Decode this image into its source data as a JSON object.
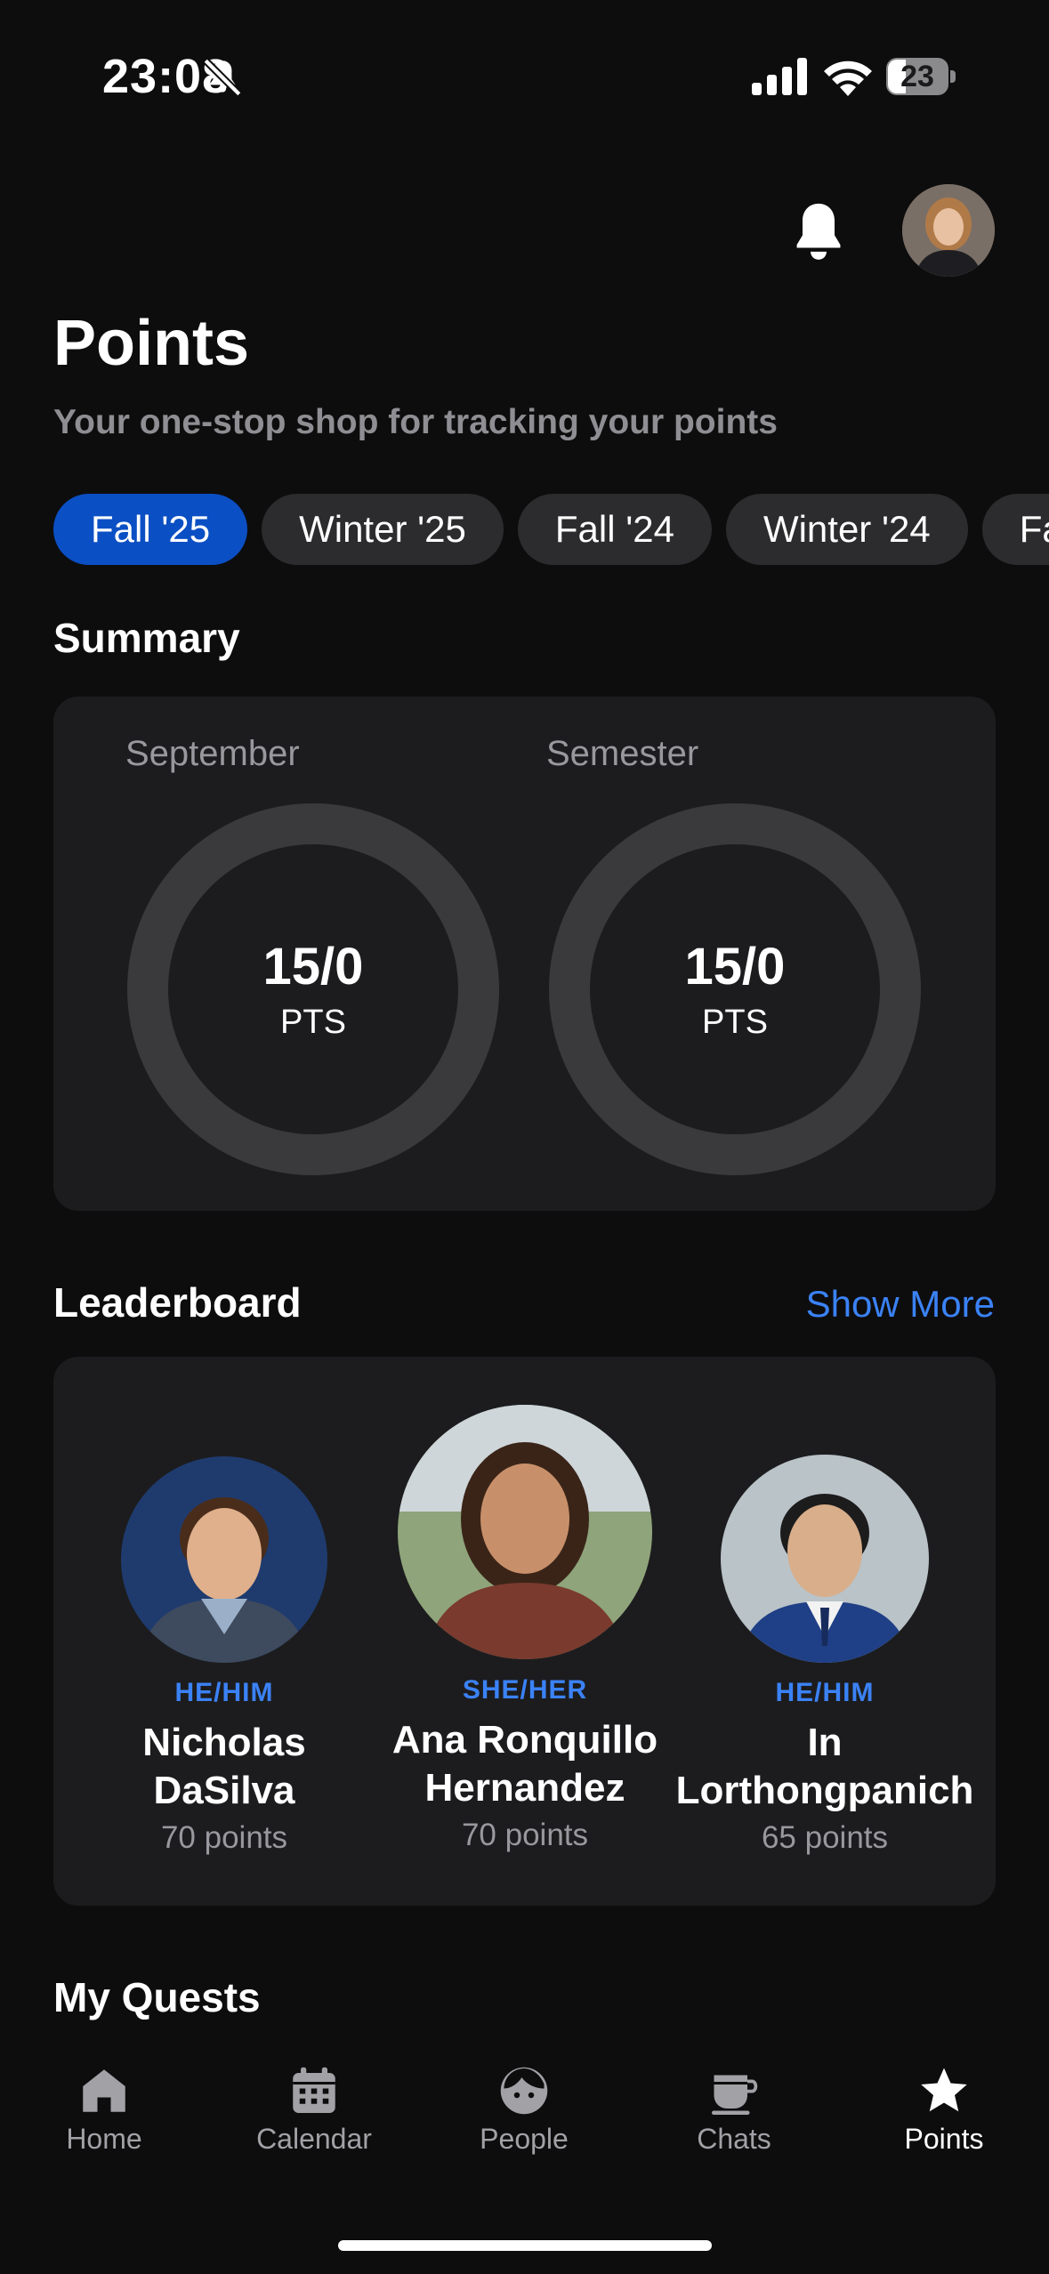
{
  "status_bar": {
    "time": "23:08",
    "battery": "23"
  },
  "header": {
    "title": "Points",
    "subtitle": "Your one-stop shop for tracking your points"
  },
  "periods": [
    "Fall '25",
    "Winter '25",
    "Fall '24",
    "Winter '24",
    "Fa"
  ],
  "active_period_index": 0,
  "summary": {
    "title": "Summary",
    "rings": [
      {
        "label": "September",
        "value": "15/0",
        "unit": "PTS",
        "progress": 0
      },
      {
        "label": "Semester",
        "value": "15/0",
        "unit": "PTS",
        "progress": 0
      }
    ]
  },
  "leaderboard": {
    "title": "Leaderboard",
    "show_more": "Show More",
    "leaders": [
      {
        "pronouns": "HE/HIM",
        "name_line1": "Nicholas",
        "name_line2": "DaSilva",
        "points": "70 points"
      },
      {
        "pronouns": "SHE/HER",
        "name_line1": "Ana Ronquillo",
        "name_line2": "Hernandez",
        "points": "70 points"
      },
      {
        "pronouns": "HE/HIM",
        "name_line1": "In",
        "name_line2": "Lorthongpanich",
        "points": "65 points"
      }
    ]
  },
  "quests": {
    "title": "My Quests"
  },
  "tabs": [
    {
      "label": "Home",
      "icon": "home-icon"
    },
    {
      "label": "Calendar",
      "icon": "calendar-icon"
    },
    {
      "label": "People",
      "icon": "face-icon"
    },
    {
      "label": "Chats",
      "icon": "coffee-cup-icon"
    },
    {
      "label": "Points",
      "icon": "star-icon",
      "active": true
    }
  ],
  "colors": {
    "accent": "#3b82f6",
    "active_pill": "#0b4fc4",
    "background": "#0d0d0e",
    "card": "#1c1c1e"
  }
}
